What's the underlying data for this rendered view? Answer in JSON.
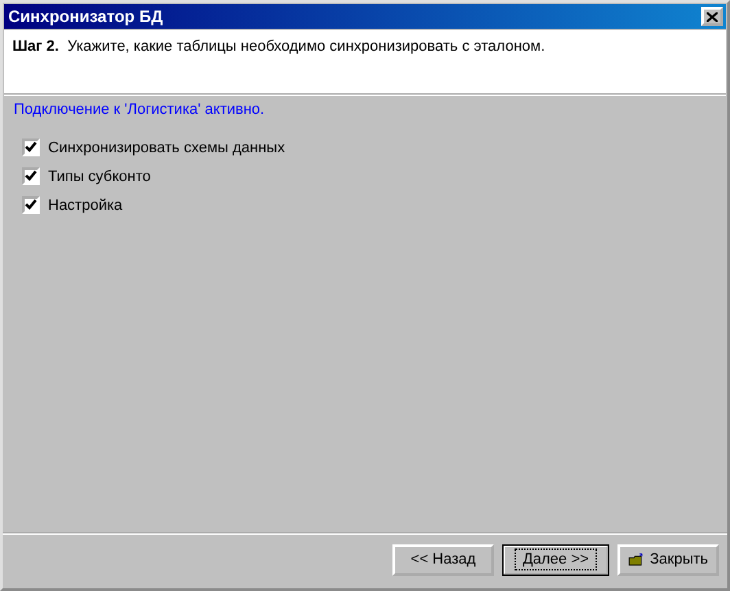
{
  "window": {
    "title": "Синхронизатор БД"
  },
  "header": {
    "step": "Шаг 2.",
    "text": "Укажите, какие таблицы необходимо синхронизировать с эталоном."
  },
  "status": "Подключение к 'Логистика' активно.",
  "options": [
    {
      "label": "Синхронизировать схемы данных",
      "checked": true
    },
    {
      "label": "Типы субконто",
      "checked": true
    },
    {
      "label": "Настройка",
      "checked": true
    }
  ],
  "buttons": [
    {
      "label": "<< Назад",
      "kind": "plain"
    },
    {
      "label": "Далее >>",
      "kind": "default"
    },
    {
      "label": "Закрыть",
      "kind": "close"
    }
  ]
}
